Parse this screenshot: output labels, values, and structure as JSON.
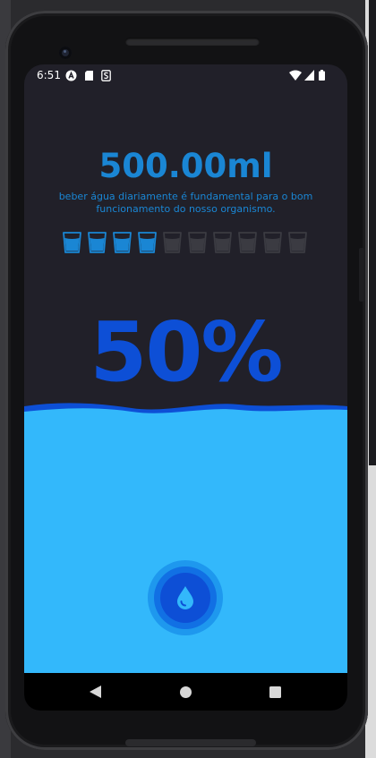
{
  "status_bar": {
    "time": "6:51"
  },
  "header": {
    "amount": "500.00ml",
    "description": "beber água diariamente é fundamental para o bom funcionamento do nosso organismo."
  },
  "cups": {
    "total": 10,
    "filled": 4,
    "filled_color": "#1a86d4",
    "empty_color": "#3b3b42"
  },
  "progress": {
    "percent_label": "50%",
    "value": 0.5
  },
  "colors": {
    "background": "#212029",
    "accent": "#1a86d4",
    "percent": "#0d4fd6",
    "water": "#33b8fb",
    "wave": "#0d4fd6"
  },
  "icons": {
    "add_water_button": "water-drop-icon",
    "nav_back": "back-triangle-icon",
    "nav_home": "home-circle-icon",
    "nav_recents": "recents-square-icon"
  }
}
